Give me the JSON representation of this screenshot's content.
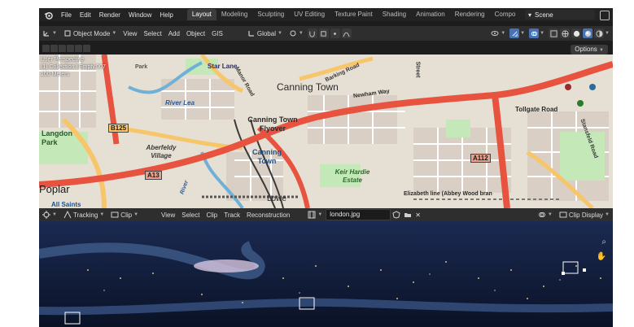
{
  "menubar": {
    "items": [
      "File",
      "Edit",
      "Render",
      "Window",
      "Help"
    ],
    "workspaces": [
      "Layout",
      "Modeling",
      "Sculpting",
      "UV Editing",
      "Texture Paint",
      "Shading",
      "Animation",
      "Rendering",
      "Compo"
    ],
    "active_workspace": "Layout",
    "scene": "Scene"
  },
  "view3d_header": {
    "mode": "Object Mode",
    "menus": [
      "View",
      "Select",
      "Add",
      "Object",
      "GIS"
    ],
    "orientation": "Global"
  },
  "viewport": {
    "info_lines": [
      "User Perspective",
      "(1) Collection | Empty.007",
      "100 Meters"
    ],
    "options_label": "Options",
    "map_labels": {
      "canning_town": "Canning Town",
      "canning_flyover": "Canning Town Flyover",
      "canning_station": "Canning Town",
      "newham_way": "Newham Way",
      "barking_road": "Barking Road",
      "manor_road": "Manor Road",
      "star_lane": "Star Lane",
      "river_lea": "River Lea",
      "tollgate_road": "Tollgate Road",
      "stansfeld_road": "Stansfeld Road",
      "keir_hardie": "Keir Hardie Estate",
      "lowe": "Lowe",
      "elizabeth_line": "Elizabeth line (Abbey Wood bran",
      "langdon_park": "Langdon Park",
      "aberfeldy": "Aberfeldy Village",
      "poplar": "Poplar",
      "all_saints": "All Saints",
      "park": "Park",
      "street": "Street",
      "river": "River",
      "b125": "B125",
      "a13": "A13",
      "a112": "A112"
    }
  },
  "clip_header": {
    "mode": "Tracking",
    "view": "Clip",
    "menus": [
      "View",
      "Select",
      "Clip",
      "Track",
      "Reconstruction"
    ],
    "filename": "london.jpg",
    "display": "Clip Display"
  },
  "colors": {
    "accent": "#4772b3",
    "primary_road": "#e8533f",
    "secondary_road": "#f7c66b",
    "park": "#c5e8b8",
    "water": "#6fb0d6"
  }
}
